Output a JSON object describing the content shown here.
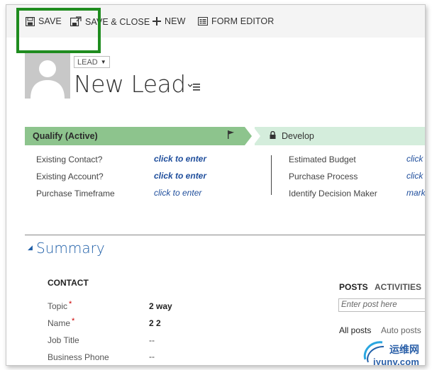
{
  "toolbar": {
    "save_label": "SAVE",
    "save_close_label": "SAVE & CLOSE",
    "new_label": "NEW",
    "form_editor_label": "FORM EDITOR"
  },
  "header": {
    "entity_label": "LEAD",
    "title": "New Lead"
  },
  "process": {
    "active_stage": "Qualify (Active)",
    "next_stage": "Develop",
    "left_fields": [
      {
        "label": "Existing Contact?",
        "value": "click to enter"
      },
      {
        "label": "Existing Account?",
        "value": "click to enter"
      },
      {
        "label": "Purchase Timeframe",
        "value": "click to enter"
      }
    ],
    "right_fields": [
      {
        "label": "Estimated Budget",
        "value": "click"
      },
      {
        "label": "Purchase Process",
        "value": "click"
      },
      {
        "label": "Identify Decision Maker",
        "value": "mark"
      }
    ],
    "colors": {
      "active": "#8dc48d",
      "next": "#d4eddc"
    }
  },
  "summary": {
    "title": "Summary",
    "contact_heading": "CONTACT",
    "fields": [
      {
        "label": "Topic",
        "required": "*",
        "value": "2 way"
      },
      {
        "label": "Name",
        "required": "*",
        "value": "2 2"
      },
      {
        "label": "Job Title",
        "required": "",
        "value": "--"
      },
      {
        "label": "Business Phone",
        "required": "",
        "value": "--"
      }
    ]
  },
  "social": {
    "tab_posts": "POSTS",
    "tab_activities": "ACTIVITIES",
    "post_placeholder": "Enter post here",
    "filter_all": "All posts",
    "filter_auto": "Auto posts"
  },
  "watermark": {
    "cn": "运维网",
    "url": "iyunv.com"
  },
  "accent_colors": {
    "highlight": "#1f8c1f",
    "link": "#1f4e9c",
    "summary": "#1f5fa8"
  }
}
